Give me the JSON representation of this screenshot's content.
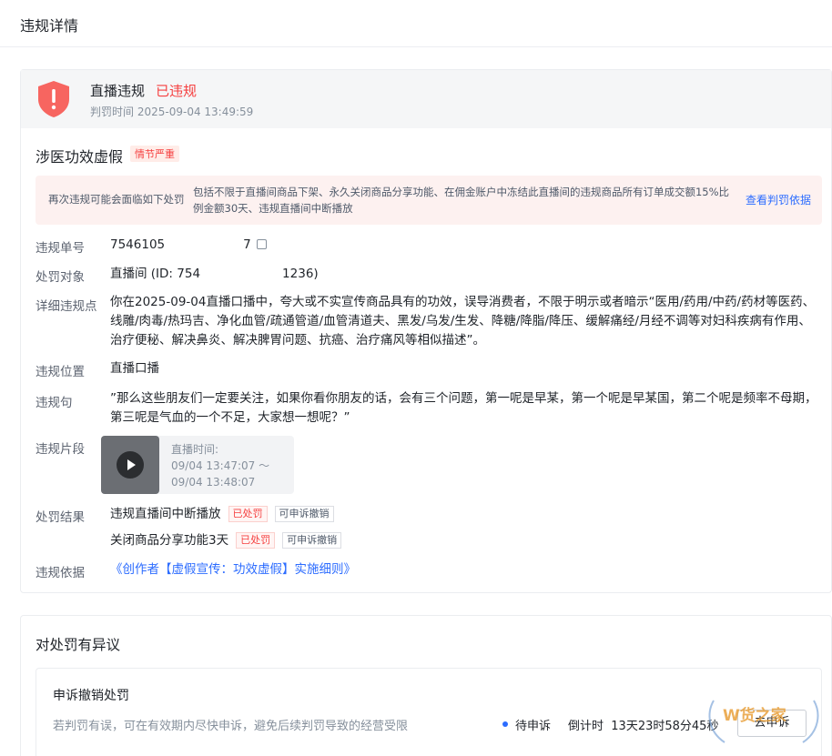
{
  "header": {
    "title": "违规详情"
  },
  "summary": {
    "title": "直播违规",
    "status": "已违规",
    "time_label": "判罚时间",
    "time_value": "2025-09-04 13:49:59"
  },
  "violation": {
    "name": "涉医功效虚假",
    "severity": "情节严重",
    "warning_label": "再次违规可能会面临如下处罚",
    "warning_text": "包括不限于直播间商品下架、永久关闭商品分享功能、在佣金账户中冻结此直播间的违规商品所有订单成交额15%比例金额30天、违规直播间中断播放",
    "basis_link_label": "查看判罚依据"
  },
  "details": {
    "id_label": "违规单号",
    "id_value": "7546105",
    "id_value_tail": "7",
    "target_label": "处罚对象",
    "target_value": "直播间 (ID: 754",
    "target_value_tail": "1236)",
    "point_label": "详细违规点",
    "point_value": "你在2025-09-04直播口播中，夸大或不实宣传商品具有的功效，误导消费者，不限于明示或者暗示“医用/药用/中药/药材等医药、线雕/肉毒/热玛吉、净化血管/疏通管道/血管清道夫、黑发/乌发/生发、降糖/降脂/降压、缓解痛经/月经不调等对妇科疾病有作用、治疗便秘、解决鼻炎、解决脾胃问题、抗癌、治疗痛风等相似描述”。",
    "position_label": "违规位置",
    "position_value": "直播口播",
    "sentence_label": "违规句",
    "sentence_value": "”那么这些朋友们一定要关注，如果你看你朋友的话，会有三个问题，第一呢是早某，第一个呢是早某国，第二个呢是频率不母期，第三呢是气血的一个不足，大家想一想呢？”",
    "clip_label": "违规片段",
    "clip_time_label": "直播时间:",
    "clip_time_start": "09/04 13:47:07 ～",
    "clip_time_end": "09/04 13:48:07",
    "result_label": "处罚结果",
    "results": [
      {
        "text": "违规直播间中断播放",
        "status": "已处罚",
        "appeal": "可申诉撤销"
      },
      {
        "text": "关闭商品分享功能3天",
        "status": "已处罚",
        "appeal": "可申诉撤销"
      }
    ],
    "basis_label": "违规依据",
    "basis_value": "《创作者【虚假宣传：功效虚假】实施细则》"
  },
  "appeal": {
    "section_title": "对处罚有异议",
    "box_title": "申诉撤销处罚",
    "description": "若判罚有误，可在有效期内尽快申诉，避免后续判罚导致的经营受限",
    "status": "待申诉",
    "countdown_label": "倒计时",
    "countdown_value": "13天23时58分45秒",
    "button_label": "去申诉"
  },
  "watermark": {
    "text": "W货之家"
  },
  "colors": {
    "accent": "#2c6cff",
    "danger": "#f53f3f",
    "muted": "#86909c"
  }
}
